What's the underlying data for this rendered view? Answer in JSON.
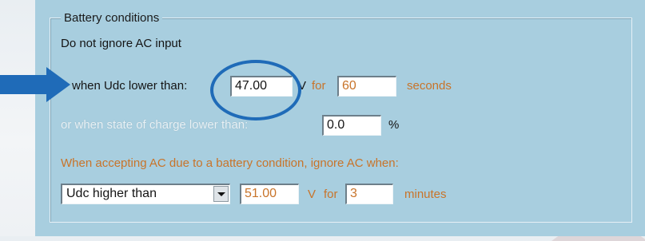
{
  "battery_conditions": {
    "group_title": "Battery conditions",
    "section_label": "Do not ignore AC input",
    "udc_row": {
      "label": "when Udc lower than:",
      "value": "47.00",
      "unit": "V",
      "for_label": "for",
      "duration": "60",
      "duration_unit": "seconds"
    },
    "soc_row": {
      "label": "or when state of charge lower than:",
      "value": "0.0",
      "unit": "%"
    },
    "accept_section": {
      "label": "When accepting AC due to a battery condition, ignore AC when:",
      "condition_select": "Udc higher than",
      "value": "51.00",
      "unit": "V",
      "for_label": "for",
      "duration": "3",
      "duration_unit": "minutes"
    }
  },
  "annotation_colors": {
    "arrow": "#1f6bb8",
    "circle": "#1f6bb8"
  }
}
